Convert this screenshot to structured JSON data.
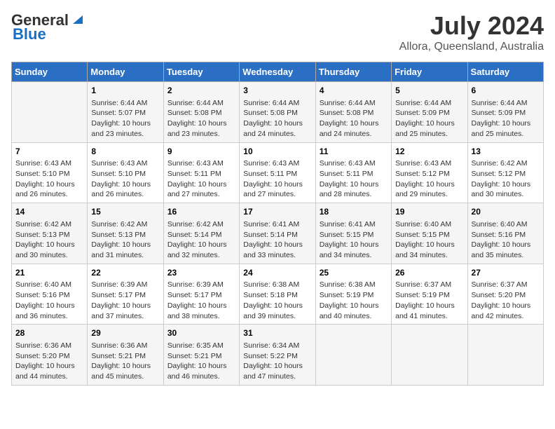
{
  "header": {
    "logo_general": "General",
    "logo_blue": "Blue",
    "title": "July 2024",
    "subtitle": "Allora, Queensland, Australia"
  },
  "days_header": [
    "Sunday",
    "Monday",
    "Tuesday",
    "Wednesday",
    "Thursday",
    "Friday",
    "Saturday"
  ],
  "weeks": [
    [
      {
        "num": "",
        "info": ""
      },
      {
        "num": "1",
        "info": "Sunrise: 6:44 AM\nSunset: 5:07 PM\nDaylight: 10 hours\nand 23 minutes."
      },
      {
        "num": "2",
        "info": "Sunrise: 6:44 AM\nSunset: 5:08 PM\nDaylight: 10 hours\nand 23 minutes."
      },
      {
        "num": "3",
        "info": "Sunrise: 6:44 AM\nSunset: 5:08 PM\nDaylight: 10 hours\nand 24 minutes."
      },
      {
        "num": "4",
        "info": "Sunrise: 6:44 AM\nSunset: 5:08 PM\nDaylight: 10 hours\nand 24 minutes."
      },
      {
        "num": "5",
        "info": "Sunrise: 6:44 AM\nSunset: 5:09 PM\nDaylight: 10 hours\nand 25 minutes."
      },
      {
        "num": "6",
        "info": "Sunrise: 6:44 AM\nSunset: 5:09 PM\nDaylight: 10 hours\nand 25 minutes."
      }
    ],
    [
      {
        "num": "7",
        "info": "Sunrise: 6:43 AM\nSunset: 5:10 PM\nDaylight: 10 hours\nand 26 minutes."
      },
      {
        "num": "8",
        "info": "Sunrise: 6:43 AM\nSunset: 5:10 PM\nDaylight: 10 hours\nand 26 minutes."
      },
      {
        "num": "9",
        "info": "Sunrise: 6:43 AM\nSunset: 5:11 PM\nDaylight: 10 hours\nand 27 minutes."
      },
      {
        "num": "10",
        "info": "Sunrise: 6:43 AM\nSunset: 5:11 PM\nDaylight: 10 hours\nand 27 minutes."
      },
      {
        "num": "11",
        "info": "Sunrise: 6:43 AM\nSunset: 5:11 PM\nDaylight: 10 hours\nand 28 minutes."
      },
      {
        "num": "12",
        "info": "Sunrise: 6:43 AM\nSunset: 5:12 PM\nDaylight: 10 hours\nand 29 minutes."
      },
      {
        "num": "13",
        "info": "Sunrise: 6:42 AM\nSunset: 5:12 PM\nDaylight: 10 hours\nand 30 minutes."
      }
    ],
    [
      {
        "num": "14",
        "info": "Sunrise: 6:42 AM\nSunset: 5:13 PM\nDaylight: 10 hours\nand 30 minutes."
      },
      {
        "num": "15",
        "info": "Sunrise: 6:42 AM\nSunset: 5:13 PM\nDaylight: 10 hours\nand 31 minutes."
      },
      {
        "num": "16",
        "info": "Sunrise: 6:42 AM\nSunset: 5:14 PM\nDaylight: 10 hours\nand 32 minutes."
      },
      {
        "num": "17",
        "info": "Sunrise: 6:41 AM\nSunset: 5:14 PM\nDaylight: 10 hours\nand 33 minutes."
      },
      {
        "num": "18",
        "info": "Sunrise: 6:41 AM\nSunset: 5:15 PM\nDaylight: 10 hours\nand 34 minutes."
      },
      {
        "num": "19",
        "info": "Sunrise: 6:40 AM\nSunset: 5:15 PM\nDaylight: 10 hours\nand 34 minutes."
      },
      {
        "num": "20",
        "info": "Sunrise: 6:40 AM\nSunset: 5:16 PM\nDaylight: 10 hours\nand 35 minutes."
      }
    ],
    [
      {
        "num": "21",
        "info": "Sunrise: 6:40 AM\nSunset: 5:16 PM\nDaylight: 10 hours\nand 36 minutes."
      },
      {
        "num": "22",
        "info": "Sunrise: 6:39 AM\nSunset: 5:17 PM\nDaylight: 10 hours\nand 37 minutes."
      },
      {
        "num": "23",
        "info": "Sunrise: 6:39 AM\nSunset: 5:17 PM\nDaylight: 10 hours\nand 38 minutes."
      },
      {
        "num": "24",
        "info": "Sunrise: 6:38 AM\nSunset: 5:18 PM\nDaylight: 10 hours\nand 39 minutes."
      },
      {
        "num": "25",
        "info": "Sunrise: 6:38 AM\nSunset: 5:19 PM\nDaylight: 10 hours\nand 40 minutes."
      },
      {
        "num": "26",
        "info": "Sunrise: 6:37 AM\nSunset: 5:19 PM\nDaylight: 10 hours\nand 41 minutes."
      },
      {
        "num": "27",
        "info": "Sunrise: 6:37 AM\nSunset: 5:20 PM\nDaylight: 10 hours\nand 42 minutes."
      }
    ],
    [
      {
        "num": "28",
        "info": "Sunrise: 6:36 AM\nSunset: 5:20 PM\nDaylight: 10 hours\nand 44 minutes."
      },
      {
        "num": "29",
        "info": "Sunrise: 6:36 AM\nSunset: 5:21 PM\nDaylight: 10 hours\nand 45 minutes."
      },
      {
        "num": "30",
        "info": "Sunrise: 6:35 AM\nSunset: 5:21 PM\nDaylight: 10 hours\nand 46 minutes."
      },
      {
        "num": "31",
        "info": "Sunrise: 6:34 AM\nSunset: 5:22 PM\nDaylight: 10 hours\nand 47 minutes."
      },
      {
        "num": "",
        "info": ""
      },
      {
        "num": "",
        "info": ""
      },
      {
        "num": "",
        "info": ""
      }
    ]
  ]
}
